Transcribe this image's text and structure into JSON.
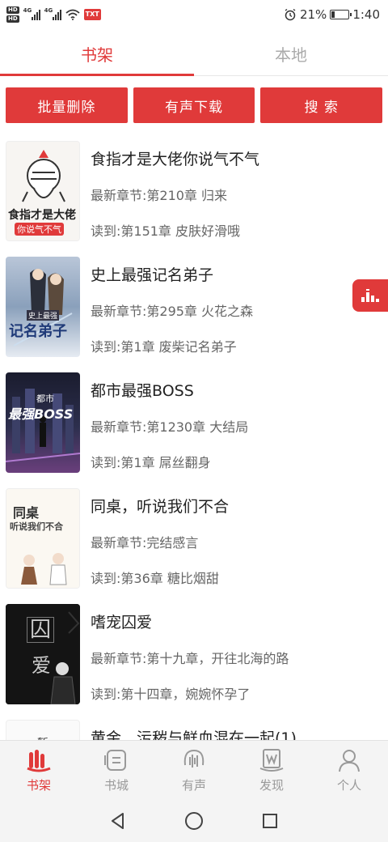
{
  "status_bar": {
    "hd1": "HD",
    "hd2": "HD",
    "sig1_label": "4G",
    "sig2_label": "4G",
    "txt_badge": "TXT",
    "battery_percent": "21%",
    "battery_level": 0.21,
    "time": "1:40"
  },
  "tabs": [
    {
      "label": "书架",
      "active": true
    },
    {
      "label": "本地",
      "active": false
    }
  ],
  "actions": {
    "batch_delete": "批量删除",
    "audio_download": "有声下载",
    "search": "搜 索"
  },
  "books": [
    {
      "title": "食指才是大佬你说气不气",
      "latest": "最新章节:第210章 归来",
      "read": "读到:第151章 皮肤好滑哦",
      "cover_text": "食指才是大佬",
      "cover_sub": "你说气不气"
    },
    {
      "title": "史上最强记名弟子",
      "latest": "最新章节:第295章 火花之森",
      "read": "读到:第1章 废柴记名弟子",
      "cover_text": "记名弟子",
      "cover_sub": "史上最强"
    },
    {
      "title": "都市最强BOSS",
      "latest": "最新章节:第1230章 大结局",
      "read": "读到:第1章 屌丝翻身",
      "cover_text": "最强BOSS",
      "cover_sub": "都市"
    },
    {
      "title": "同桌，听说我们不合",
      "latest": "最新章节:完结感言",
      "read": "读到:第36章 糖比烟甜",
      "cover_text": "同桌",
      "cover_sub": "听说我们不合"
    },
    {
      "title": "嗜宠囚爱",
      "latest": "最新章节:第十九章，开往北海的路",
      "read": "读到:第十四章，婉婉怀孕了",
      "cover_text": "囚",
      "cover_sub": "爱"
    },
    {
      "title": "黄金、污秽与鲜血混在一起(1)",
      "latest": "",
      "read": "",
      "cover_text": "暂",
      "cover_sub": ""
    }
  ],
  "bottom_nav": [
    {
      "label": "书架",
      "icon": "bookshelf-icon",
      "active": true
    },
    {
      "label": "书城",
      "icon": "bookstore-icon",
      "active": false
    },
    {
      "label": "有声",
      "icon": "audio-icon",
      "active": false
    },
    {
      "label": "发现",
      "icon": "discover-icon",
      "active": false
    },
    {
      "label": "个人",
      "icon": "person-icon",
      "active": false
    }
  ],
  "colors": {
    "accent": "#e03a3a",
    "inactive": "#999999"
  }
}
